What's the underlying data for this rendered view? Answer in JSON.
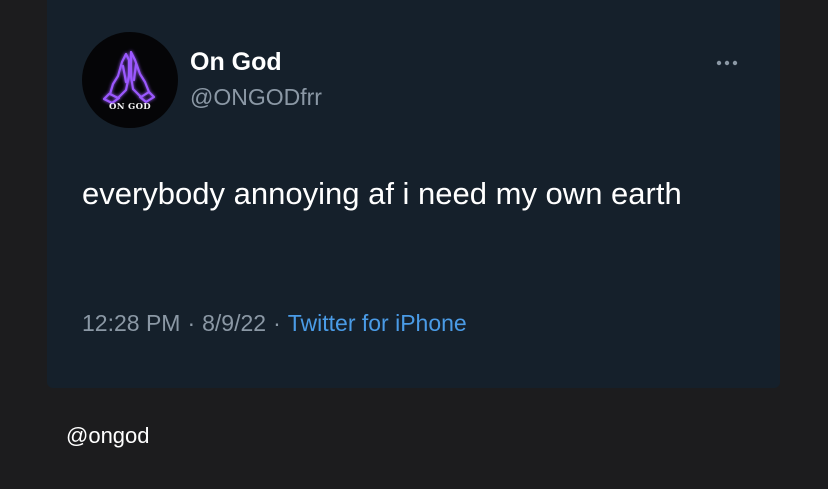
{
  "tweet": {
    "avatar": {
      "icon": "praying-hands-icon",
      "label": "ON GOD",
      "icon_color": "#9b59ff"
    },
    "display_name": "On God",
    "handle": "@ONGODfrr",
    "more_icon": "more-dots-icon",
    "text": "everybody annoying af i need my own earth",
    "time": "12:28 PM",
    "separator_1": "·",
    "date": "8/9/22",
    "separator_2": "·",
    "source": "Twitter for iPhone"
  },
  "caption": "@ongod",
  "colors": {
    "page_background": "#1c1c1e",
    "card_background": "#15202b",
    "text_primary": "#ffffff",
    "text_secondary": "#8b98a5",
    "link": "#4a9be6"
  }
}
